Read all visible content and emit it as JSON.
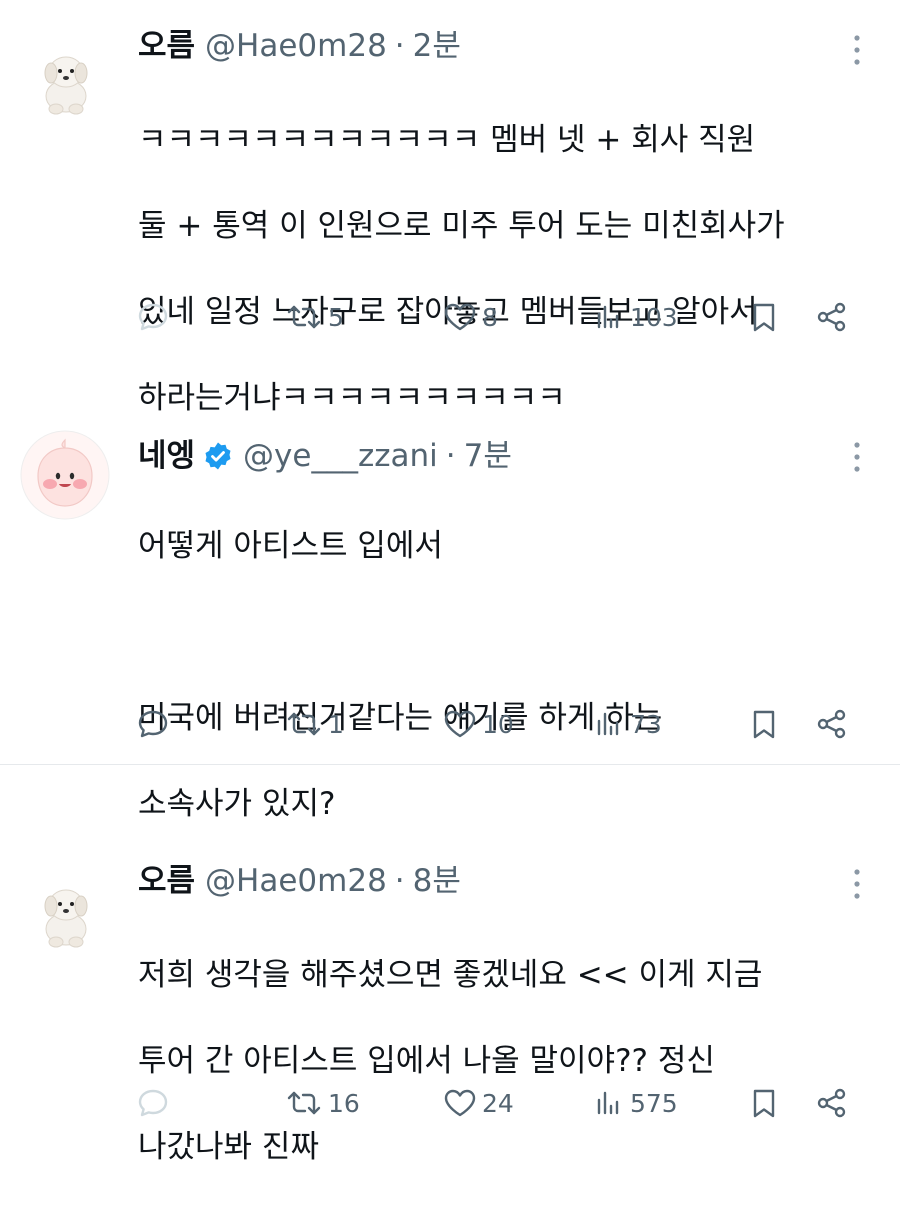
{
  "tweets": [
    {
      "display_name": "오름",
      "handle": "@Hae0m28",
      "separator": "·",
      "time": "2분",
      "verified": false,
      "avatar": "white-puppy-plush-icon",
      "lines": [
        "ㅋㅋㅋㅋㅋㅋㅋㅋㅋㅋㅋㅋ 멤버 넷 + 회사 직원",
        "둘 + 통역 이 인원으로 미주 투어 도는 미친회사가",
        "있네 일정 느자구로 잡아놓고 멤버들보고 알아서",
        "하라는거냐ㅋㅋㅋㅋㅋㅋㅋㅋㅋㅋ"
      ],
      "stats": {
        "replies": "",
        "retweets": "5",
        "likes": "8",
        "views": "103"
      }
    },
    {
      "display_name": "네엥",
      "handle": "@ye___zzani",
      "separator": "·",
      "time": "7분",
      "verified": true,
      "avatar": "pink-peach-character-icon",
      "lines": [
        "어떻게 아티스트 입에서",
        "",
        "미국에 버려진거같다는 얘기를 하게 하는",
        "소속사가 있지?"
      ],
      "stats": {
        "replies": "",
        "retweets": "1",
        "likes": "10",
        "views": "73"
      }
    },
    {
      "display_name": "오름",
      "handle": "@Hae0m28",
      "separator": "·",
      "time": "8분",
      "verified": false,
      "avatar": "white-puppy-plush-icon",
      "lines": [
        "저희 생각을 해주셨으면 좋겠네요 << 이게 지금",
        "투어 간 아티스트 입에서 나올 말이야?? 정신",
        "나갔나봐 진짜"
      ],
      "stats": {
        "replies": "",
        "retweets": "16",
        "likes": "24",
        "views": "575"
      }
    }
  ],
  "colors": {
    "text": "#0f1419",
    "secondary": "#536471",
    "reply_icon_light": "#cfd9de",
    "verified_badge": "#1d9bf0",
    "divider": "#e6e9ec",
    "peach_avatar": "#fde2e0",
    "peach_cheek": "#f7a8b0"
  }
}
